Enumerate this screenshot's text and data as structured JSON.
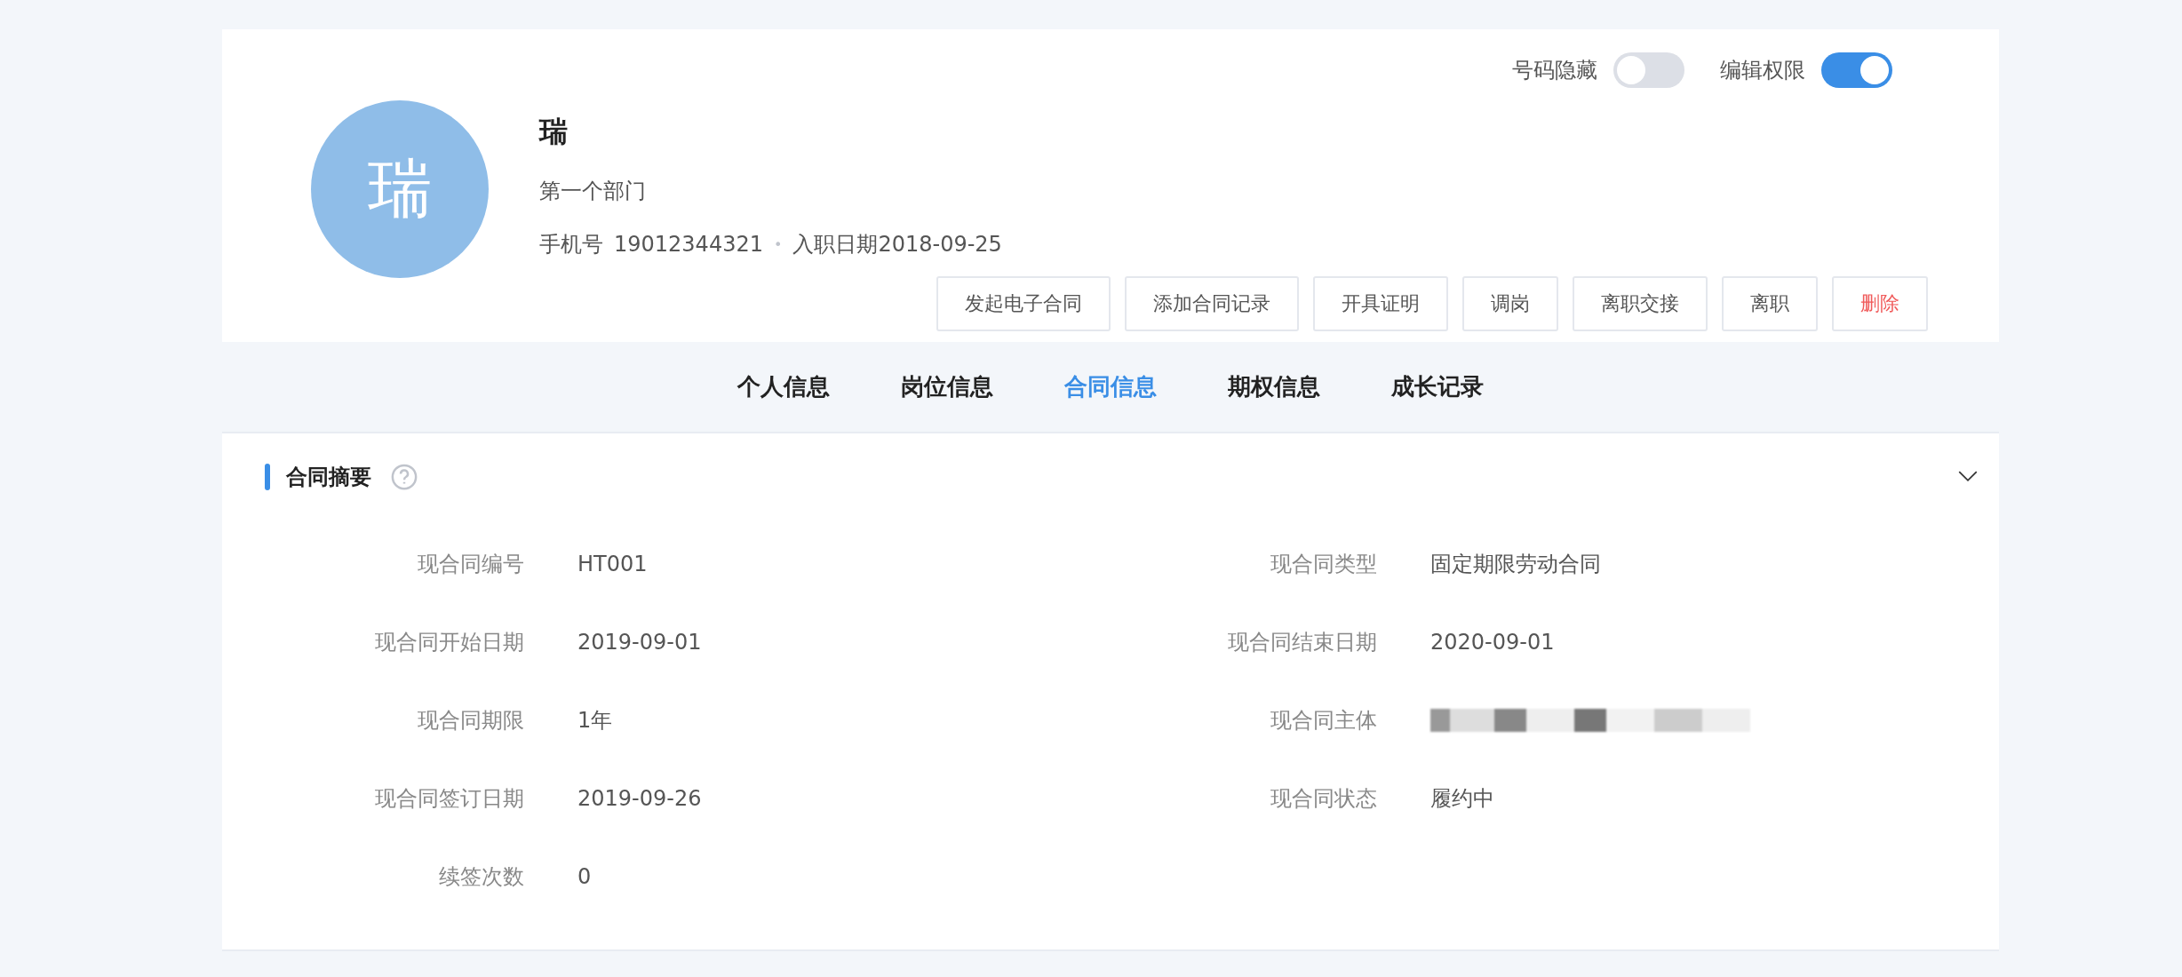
{
  "toggles": [
    {
      "label": "号码隐藏",
      "on": false
    },
    {
      "label": "编辑权限",
      "on": true
    }
  ],
  "profile": {
    "avatar_text": "瑞",
    "name": "瑞",
    "department": "第一个部门",
    "phone_label": "手机号",
    "phone": "19012344321",
    "separator": "•",
    "hire_date": "入职日期2018-09-25"
  },
  "actions": [
    {
      "label": "发起电子合同",
      "kind": "normal"
    },
    {
      "label": "添加合同记录",
      "kind": "normal"
    },
    {
      "label": "开具证明",
      "kind": "normal"
    },
    {
      "label": "调岗",
      "kind": "normal"
    },
    {
      "label": "离职交接",
      "kind": "normal"
    },
    {
      "label": "离职",
      "kind": "normal"
    },
    {
      "label": "删除",
      "kind": "danger"
    }
  ],
  "tabs": [
    {
      "label": "个人信息",
      "selected": false
    },
    {
      "label": "岗位信息",
      "selected": false
    },
    {
      "label": "合同信息",
      "selected": true
    },
    {
      "label": "期权信息",
      "selected": false
    },
    {
      "label": "成长记录",
      "selected": false
    }
  ],
  "section": {
    "title": "合同摘要",
    "expanded": true,
    "fields": [
      {
        "label": "现合同编号",
        "kind": "text",
        "value": "HT001"
      },
      {
        "label": "现合同类型",
        "kind": "text",
        "value": "固定期限劳动合同"
      },
      {
        "label": "现合同开始日期",
        "kind": "text",
        "value": "2019-09-01"
      },
      {
        "label": "现合同结束日期",
        "kind": "text",
        "value": "2020-09-01"
      },
      {
        "label": "现合同期限",
        "kind": "text",
        "value": "1年"
      },
      {
        "label": "现合同主体",
        "kind": "redacted"
      },
      {
        "label": "现合同签订日期",
        "kind": "text",
        "value": "2019-09-26"
      },
      {
        "label": "现合同状态",
        "kind": "text",
        "value": "履约中"
      },
      {
        "label": "续签次数",
        "kind": "text",
        "value": "0"
      }
    ]
  }
}
